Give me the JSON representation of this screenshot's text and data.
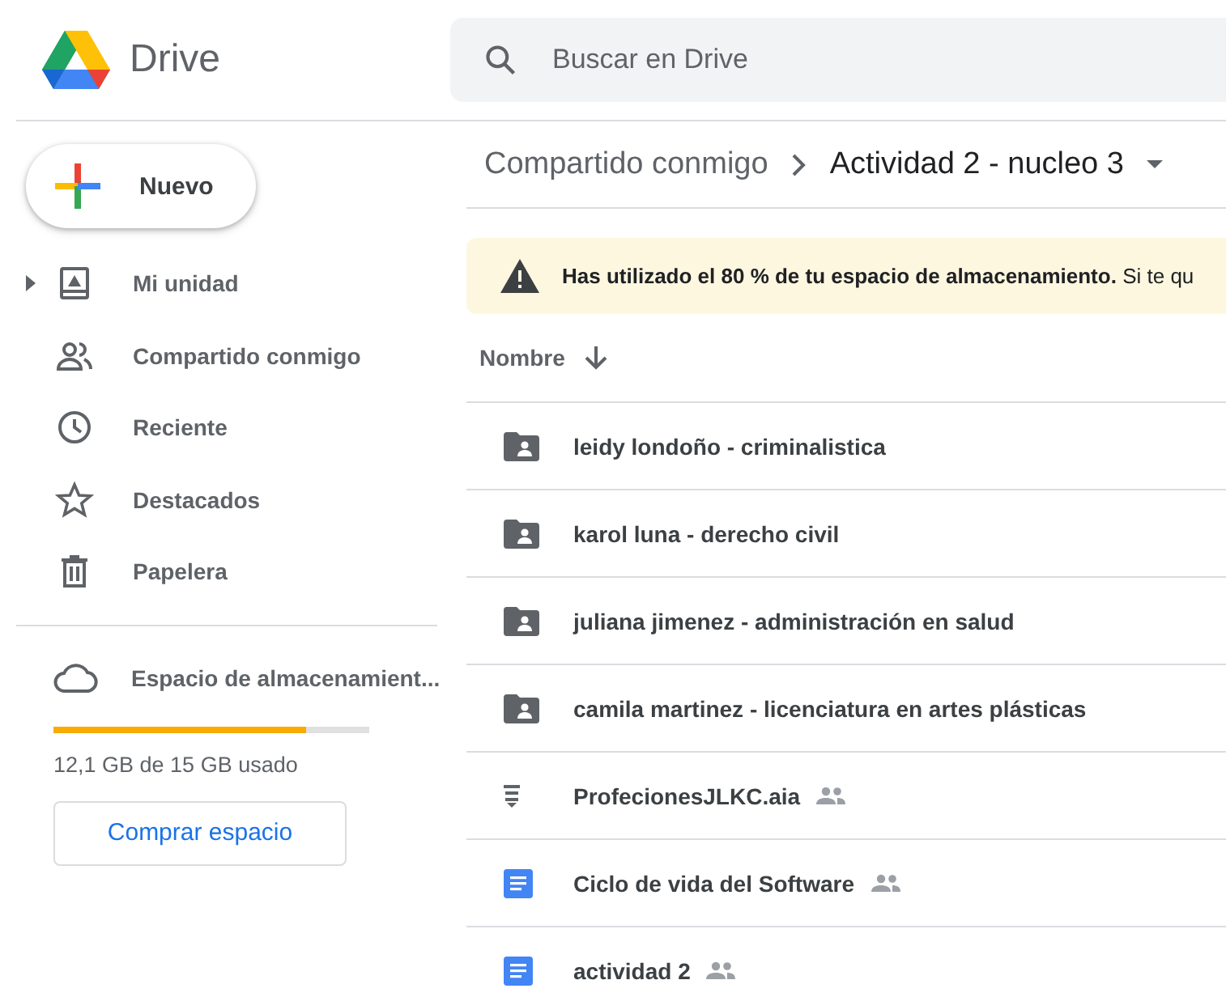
{
  "app": {
    "name": "Drive"
  },
  "search": {
    "placeholder": "Buscar en Drive"
  },
  "new_button": {
    "label": "Nuevo"
  },
  "sidebar": {
    "items": [
      {
        "kind": "drive",
        "label": "Mi unidad",
        "expandable": true
      },
      {
        "kind": "shared",
        "label": "Compartido conmigo",
        "expandable": false
      },
      {
        "kind": "recent",
        "label": "Reciente",
        "expandable": false
      },
      {
        "kind": "starred",
        "label": "Destacados",
        "expandable": false
      },
      {
        "kind": "trash",
        "label": "Papelera",
        "expandable": false
      }
    ]
  },
  "storage": {
    "label": "Espacio de almacenamient...",
    "level": 0.8,
    "usage": "12,1 GB de 15 GB usado",
    "button": "Comprar espacio"
  },
  "breadcrumb": [
    "Compartido conmigo",
    "Actividad 2 - nucleo 3"
  ],
  "alert": {
    "text": "**Has utilizado el 80 % de tu espacio de almacenamiento.** Si te qu"
  },
  "table": {
    "columns": [
      {
        "label": "Nombre"
      }
    ],
    "rows": [
      {
        "kind": "shared-folder",
        "name": "leidy londoño - criminalistica",
        "shared": false
      },
      {
        "kind": "shared-folder",
        "name": "karol luna - derecho civil",
        "shared": false
      },
      {
        "kind": "shared-folder",
        "name": "juliana jimenez - administración en salud",
        "shared": false
      },
      {
        "kind": "shared-folder",
        "name": "camila martinez - licenciatura en artes plásticas",
        "shared": false
      },
      {
        "kind": "app",
        "name": "ProfecionesJLKC.aia",
        "shared": true
      },
      {
        "kind": "doc",
        "name": "Ciclo de vida del Software",
        "shared": true
      },
      {
        "kind": "doc",
        "name": "actividad 2",
        "shared": true
      }
    ]
  }
}
